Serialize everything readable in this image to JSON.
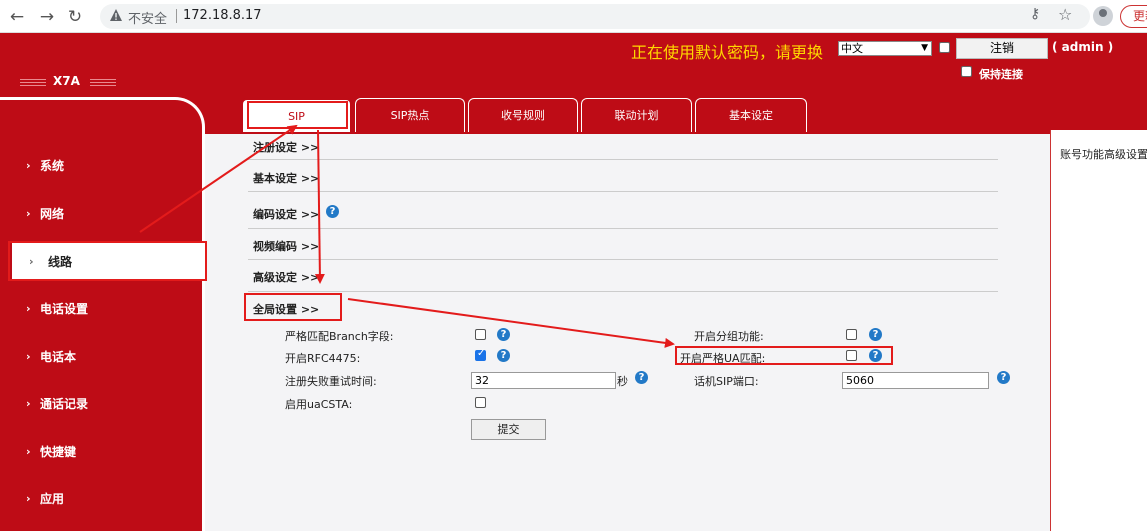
{
  "browser": {
    "insecure_label": "不安全",
    "url": "172.18.8.17",
    "update_label": "更新"
  },
  "header": {
    "logo": "X7A",
    "default_password_warning": "正在使用默认密码，请更换",
    "language": "中文",
    "logout_label": "注销",
    "user": "( admin )",
    "keep_connected_label": "保持连接"
  },
  "sidebar": {
    "items": [
      {
        "label": "系统"
      },
      {
        "label": "网络"
      },
      {
        "label": "线路",
        "active": true
      },
      {
        "label": "电话设置"
      },
      {
        "label": "电话本"
      },
      {
        "label": "通话记录"
      },
      {
        "label": "快捷键"
      },
      {
        "label": "应用"
      }
    ]
  },
  "tabs": [
    {
      "label": "SIP",
      "active": true
    },
    {
      "label": "SIP热点"
    },
    {
      "label": "收号规则"
    },
    {
      "label": "联动计划"
    },
    {
      "label": "基本设定"
    }
  ],
  "sections": [
    {
      "label": "注册设定 >>"
    },
    {
      "label": "基本设定 >>"
    },
    {
      "label": "编码设定 >>"
    },
    {
      "label": "视频编码 >>"
    },
    {
      "label": "高级设定 >>"
    },
    {
      "label": "全局设置 >>"
    }
  ],
  "global_settings": {
    "strict_branch": {
      "label": "严格匹配Branch字段:",
      "checked": false
    },
    "rfc4475": {
      "label": "开启RFC4475:",
      "checked": true
    },
    "retry_time": {
      "label": "注册失败重试时间:",
      "value": "32",
      "unit": "秒"
    },
    "uacsta": {
      "label": "启用uaCSTA:",
      "checked": false
    },
    "group_feature": {
      "label": "开启分组功能:",
      "checked": false
    },
    "strict_ua": {
      "label": "开启严格UA匹配:",
      "checked": false
    },
    "sip_port": {
      "label": "话机SIP端口:",
      "value": "5060"
    },
    "submit_label": "提交"
  },
  "right_panel": {
    "line1": "账号功能高级设置"
  },
  "colors": {
    "brand_red": "#be0c16",
    "warning_yellow": "#ffd800",
    "annotation_red": "#e31b1b",
    "help_blue": "#2279c7"
  }
}
